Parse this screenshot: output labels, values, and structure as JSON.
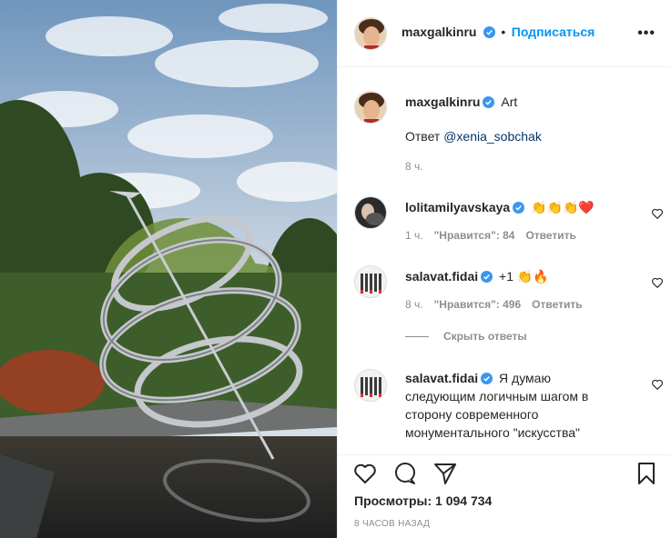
{
  "post": {
    "author": "maxgalkinru",
    "follow_label": "Подписаться",
    "separator": "•",
    "more_label": "•••"
  },
  "caption": {
    "author": "maxgalkinru",
    "text": "Art",
    "reply_prefix": "Ответ",
    "mention": "@xenia_sobchak",
    "time": "8 ч."
  },
  "comments": [
    {
      "author": "lolitamilyavskaya",
      "text": "👏👏👏❤️",
      "time": "1 ч.",
      "likes": "\"Нравится\": 84",
      "reply": "Ответить"
    },
    {
      "author": "salavat.fidai",
      "text": "+1 👏🔥",
      "time": "8 ч.",
      "likes": "\"Нравится\": 496",
      "reply": "Ответить"
    }
  ],
  "hide_replies": "Скрыть ответы",
  "reply_comment": {
    "author": "salavat.fidai",
    "line1": "Я думаю",
    "line2": "следующим логичным шагом в",
    "line3": "сторону современного",
    "line4": "монументального \"искусства\""
  },
  "stats": {
    "views": "Просмотры: 1 094 734",
    "posted": "8 ЧАСОВ НАЗАД"
  },
  "colors": {
    "accent": "#0095f6",
    "verified": "#3897f0",
    "muted": "#8e8e8e"
  },
  "icons": [
    "verified-badge-icon",
    "heart-icon",
    "comment-icon",
    "share-icon",
    "bookmark-icon",
    "more-icon"
  ]
}
